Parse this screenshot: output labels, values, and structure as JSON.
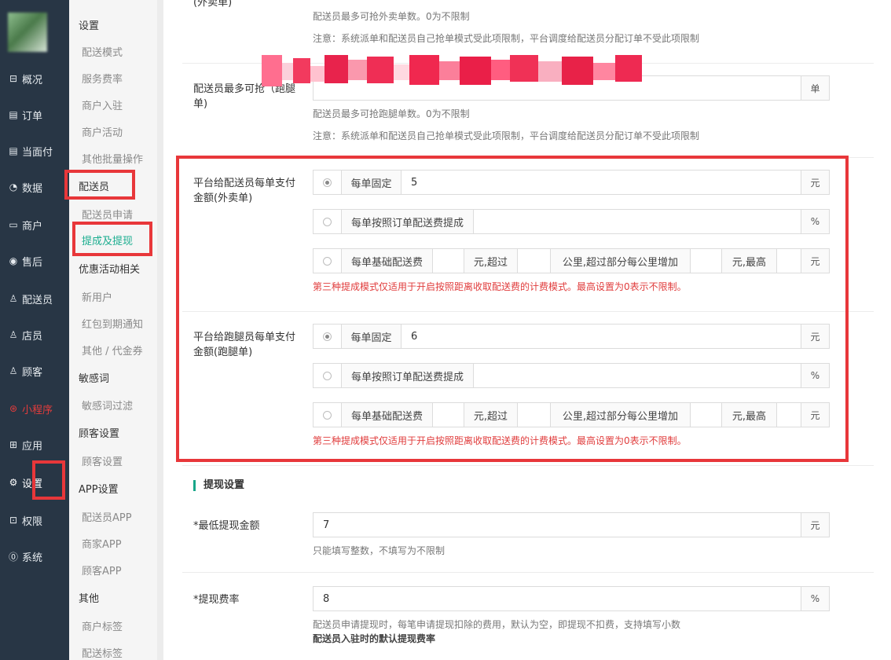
{
  "sidebar": {
    "items": [
      {
        "label": "概况",
        "icon": "overview-icon",
        "glyph": "⊟"
      },
      {
        "label": "订单",
        "icon": "order-icon",
        "glyph": "▤"
      },
      {
        "label": "当面付",
        "icon": "pay-icon",
        "glyph": "▤"
      },
      {
        "label": "数据",
        "icon": "data-icon",
        "glyph": "◔"
      },
      {
        "label": "商户",
        "icon": "merchant-icon",
        "glyph": "▭"
      },
      {
        "label": "售后",
        "icon": "after-sale-icon",
        "glyph": "◉"
      },
      {
        "label": "配送员",
        "icon": "courier-icon",
        "glyph": "♙"
      },
      {
        "label": "店员",
        "icon": "clerk-icon",
        "glyph": "♙"
      },
      {
        "label": "顾客",
        "icon": "customer-icon",
        "glyph": "♙"
      },
      {
        "label": "小程序",
        "icon": "mini-program-icon",
        "glyph": "⊛"
      },
      {
        "label": "应用",
        "icon": "apps-icon",
        "glyph": "⊞"
      },
      {
        "label": "设置",
        "icon": "settings-icon",
        "glyph": "⚙"
      },
      {
        "label": "权限",
        "icon": "permission-icon",
        "glyph": "⊡"
      },
      {
        "label": "系统",
        "icon": "system-icon",
        "glyph": "⓪"
      }
    ]
  },
  "subnav": {
    "items": [
      {
        "label": "设置",
        "kind": "head"
      },
      {
        "label": "配送模式",
        "kind": "item"
      },
      {
        "label": "服务费率",
        "kind": "item"
      },
      {
        "label": "商户入驻",
        "kind": "item"
      },
      {
        "label": "商户活动",
        "kind": "item"
      },
      {
        "label": "其他批量操作",
        "kind": "item"
      },
      {
        "label": "配送员",
        "kind": "head"
      },
      {
        "label": "配送员申请",
        "kind": "item"
      },
      {
        "label": "提成及提现",
        "kind": "item"
      },
      {
        "label": "优惠活动相关",
        "kind": "head"
      },
      {
        "label": "新用户",
        "kind": "item"
      },
      {
        "label": "红包到期通知",
        "kind": "item"
      },
      {
        "label": "其他 / 代金券",
        "kind": "item"
      },
      {
        "label": "敏感词",
        "kind": "head"
      },
      {
        "label": "敏感词过滤",
        "kind": "item"
      },
      {
        "label": "顾客设置",
        "kind": "head"
      },
      {
        "label": "顾客设置",
        "kind": "item"
      },
      {
        "label": "APP设置",
        "kind": "head"
      },
      {
        "label": "配送员APP",
        "kind": "item"
      },
      {
        "label": "商家APP",
        "kind": "item"
      },
      {
        "label": "顾客APP",
        "kind": "item"
      },
      {
        "label": "其他",
        "kind": "head"
      },
      {
        "label": "商户标签",
        "kind": "item"
      },
      {
        "label": "配送标签",
        "kind": "item"
      }
    ]
  },
  "main": {
    "top_label_partial": "(外卖单)",
    "top_hint1": "配送员最多可抢外卖单数。0为不限制",
    "top_hint2": "注意：系统派单和配送员自己抢单模式受此项限制，平台调度给配送员分配订单不受此项限制",
    "errand_label": "配送员最多可抢（跑腿单)",
    "errand_unit": "单",
    "errand_hint1": "配送员最多可抢跑腿单数。0为不限制",
    "errand_hint2": "注意：系统派单和配送员自己抢单模式受此项限制，平台调度给配送员分配订单不受此项限制",
    "takeout_pay": {
      "label": "平台给配送员每单支付金额(外卖单)",
      "fixed_label": "每单固定",
      "fixed_value": "5",
      "unit_yuan": "元",
      "pct_label": "每单按照订单配送费提成",
      "unit_pct": "%",
      "base_label": "每单基础配送费",
      "over_label": "元,超过",
      "km_label": "公里,超过部分每公里增加",
      "max_label": "元,最高",
      "note": "第三种提成模式仅适用于开启按照距离收取配送费的计费模式。最高设置为0表示不限制。"
    },
    "errand_pay": {
      "label": "平台给跑腿员每单支付金额(跑腿单)",
      "fixed_label": "每单固定",
      "fixed_value": "6",
      "unit_yuan": "元",
      "pct_label": "每单按照订单配送费提成",
      "unit_pct": "%",
      "base_label": "每单基础配送费",
      "over_label": "元,超过",
      "km_label": "公里,超过部分每公里增加",
      "max_label": "元,最高",
      "note": "第三种提成模式仅适用于开启按照距离收取配送费的计费模式。最高设置为0表示不限制。"
    },
    "withdraw_title": "提现设置",
    "min_label": "*最低提现金额",
    "min_value": "7",
    "min_unit": "元",
    "min_hint": "只能填写整数，不填写为不限制",
    "rate_label": "*提现费率",
    "rate_value": "8",
    "rate_unit": "%",
    "rate_hint1": "配送员申请提现时，每笔申请提现扣除的费用，默认为空，即提现不扣费，支持填写小数",
    "rate_hint2": "配送员入驻时的默认提现费率"
  },
  "colors": {
    "sidebar_bg": "#283645",
    "accent": "#1aad8f",
    "highlight_red": "#e8373a"
  }
}
